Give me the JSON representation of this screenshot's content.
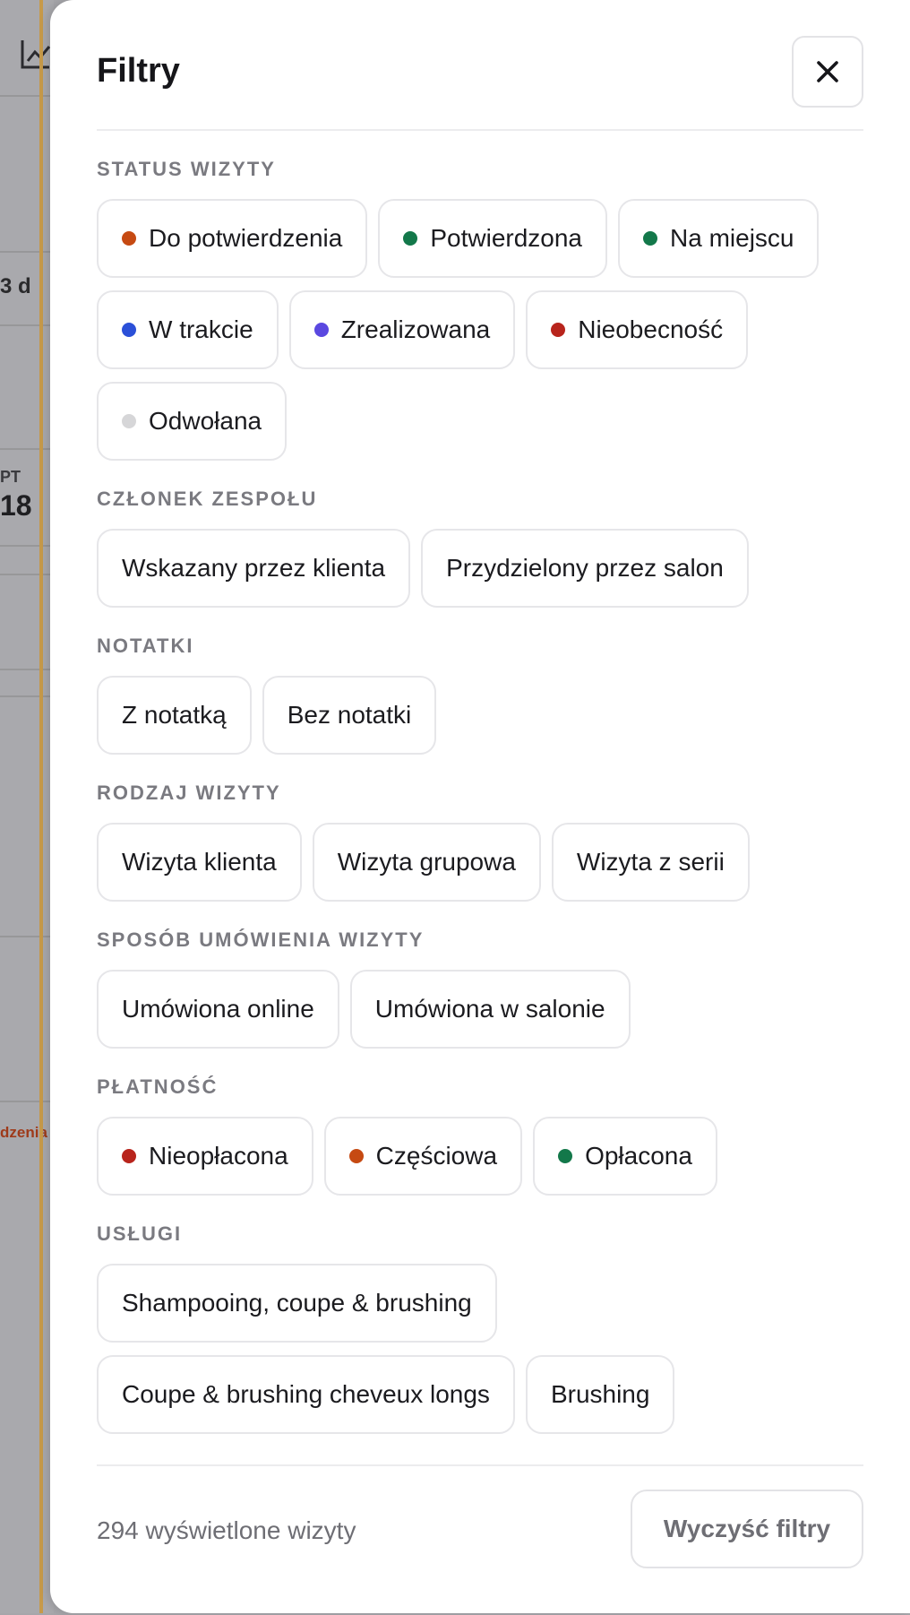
{
  "background": {
    "days_label": "3 d",
    "weekday": "PT",
    "date": "18",
    "event_text": "dzenia"
  },
  "drawer": {
    "title": "Filtry",
    "close_icon": "close-icon"
  },
  "sections": [
    {
      "title": "STATUS WIZYTY",
      "chips": [
        {
          "label": "Do potwierdzenia",
          "dot": "#c64a12"
        },
        {
          "label": "Potwierdzona",
          "dot": "#13784a"
        },
        {
          "label": "Na miejscu",
          "dot": "#13784a"
        },
        {
          "label": "W trakcie",
          "dot": "#2b50d8"
        },
        {
          "label": "Zrealizowana",
          "dot": "#5a48e0"
        },
        {
          "label": "Nieobecność",
          "dot": "#b8241c"
        },
        {
          "label": "Odwołana",
          "dot": "#d6d6d8"
        }
      ]
    },
    {
      "title": "CZŁONEK ZESPOŁU",
      "chips": [
        {
          "label": "Wskazany przez klienta"
        },
        {
          "label": "Przydzielony przez salon"
        }
      ]
    },
    {
      "title": "NOTATKI",
      "chips": [
        {
          "label": "Z notatką"
        },
        {
          "label": "Bez notatki"
        }
      ]
    },
    {
      "title": "RODZAJ WIZYTY",
      "chips": [
        {
          "label": "Wizyta klienta"
        },
        {
          "label": "Wizyta grupowa"
        },
        {
          "label": "Wizyta z serii"
        }
      ]
    },
    {
      "title": "SPOSÓB UMÓWIENIA WIZYTY",
      "chips": [
        {
          "label": "Umówiona online"
        },
        {
          "label": "Umówiona w salonie"
        }
      ]
    },
    {
      "title": "PŁATNOŚĆ",
      "chips": [
        {
          "label": "Nieopłacona",
          "dot": "#b8241c"
        },
        {
          "label": "Częściowa",
          "dot": "#c64a12"
        },
        {
          "label": "Opłacona",
          "dot": "#13784a"
        }
      ]
    },
    {
      "title": "USŁUGI",
      "chips": [
        {
          "label": "Shampooing, coupe & brushing"
        },
        {
          "label": "Coupe & brushing cheveux longs"
        },
        {
          "label": "Brushing"
        }
      ]
    }
  ],
  "footer": {
    "count_text": "294 wyświetlone wizyty",
    "clear_label": "Wyczyść filtry"
  }
}
